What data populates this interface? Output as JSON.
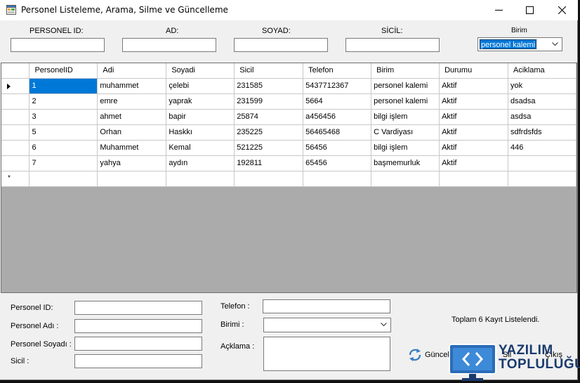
{
  "window": {
    "title": "Personel Listeleme, Arama, Silme ve Güncelleme"
  },
  "search": {
    "personel_id_label": "PERSONEL ID:",
    "ad_label": "AD:",
    "soyad_label": "SOYAD:",
    "sicil_label": "SİCİL:",
    "birim_label": "Birim",
    "birim_selected": "personel kalemi"
  },
  "grid": {
    "columns": [
      "PersonelID",
      "Adi",
      "Soyadi",
      "Sicil",
      "Telefon",
      "Birim",
      "Durumu",
      "Aciklama"
    ],
    "rows": [
      [
        "1",
        "muhammet",
        "çelebi",
        "231585",
        "5437712367",
        "personel kalemi",
        "Aktif",
        "yok"
      ],
      [
        "2",
        "emre",
        "yaprak",
        "231599",
        "5664",
        "personel kalemi",
        "Aktif",
        "dsadsa"
      ],
      [
        "3",
        "ahmet",
        "bapir",
        "25874",
        "a456456",
        "bilgi işlem",
        "Aktif",
        "asdsa"
      ],
      [
        "5",
        "Orhan",
        "Haskkı",
        "235225",
        "56465468",
        "C Vardiyası",
        "Aktif",
        "sdfrdsfds"
      ],
      [
        "6",
        "Muhammet",
        "Kemal",
        "521225",
        "56456",
        "bilgi işlem",
        "Aktif",
        "446"
      ],
      [
        "7",
        "yahya",
        "aydın",
        "192811",
        "65456",
        "başmemurluk",
        "Aktif",
        ""
      ]
    ],
    "new_row_marker": "*"
  },
  "form": {
    "personel_id_label": "Personel ID:",
    "personel_adi_label": "Personel Adı :",
    "personel_soyadi_label": "Personel Soyadı :",
    "sicil_label": "Sicil :",
    "telefon_label": "Telefon :",
    "birimi_label": "Birimi :",
    "aciklama_label": "Açklama :"
  },
  "status": {
    "total": "Toplam 6 Kayıt Listelendi."
  },
  "actions": {
    "guncelle_label": "Güncelle",
    "sil_label": "Sil",
    "cikis_label": "Çıkış"
  },
  "watermark": {
    "line1": "YAZILIM",
    "line2": "TOPLULUĞU"
  },
  "colors": {
    "selection": "#0078d7",
    "grid_background": "#ababab",
    "window_background": "#f0f0f0",
    "watermark": "#1a3a6e"
  }
}
